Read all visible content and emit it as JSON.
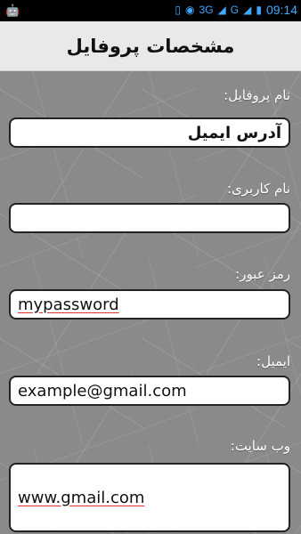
{
  "status_bar": {
    "left_icon": "android-icon",
    "network": "3G",
    "carrier_g": "G",
    "time": "09:14"
  },
  "header": {
    "title": "مشخصات پروفایل"
  },
  "form": {
    "profile_name": {
      "label": "نام پروفایل:",
      "value": "آدرس ایمیل"
    },
    "username": {
      "label": "نام کاربری:",
      "value": ""
    },
    "password": {
      "label": "رمز عبور:",
      "value": "mypassword"
    },
    "email": {
      "label": "ایمیل:",
      "value": "example@gmail.com"
    },
    "website": {
      "label": "وب سایت:",
      "value": "www.gmail.com"
    }
  }
}
